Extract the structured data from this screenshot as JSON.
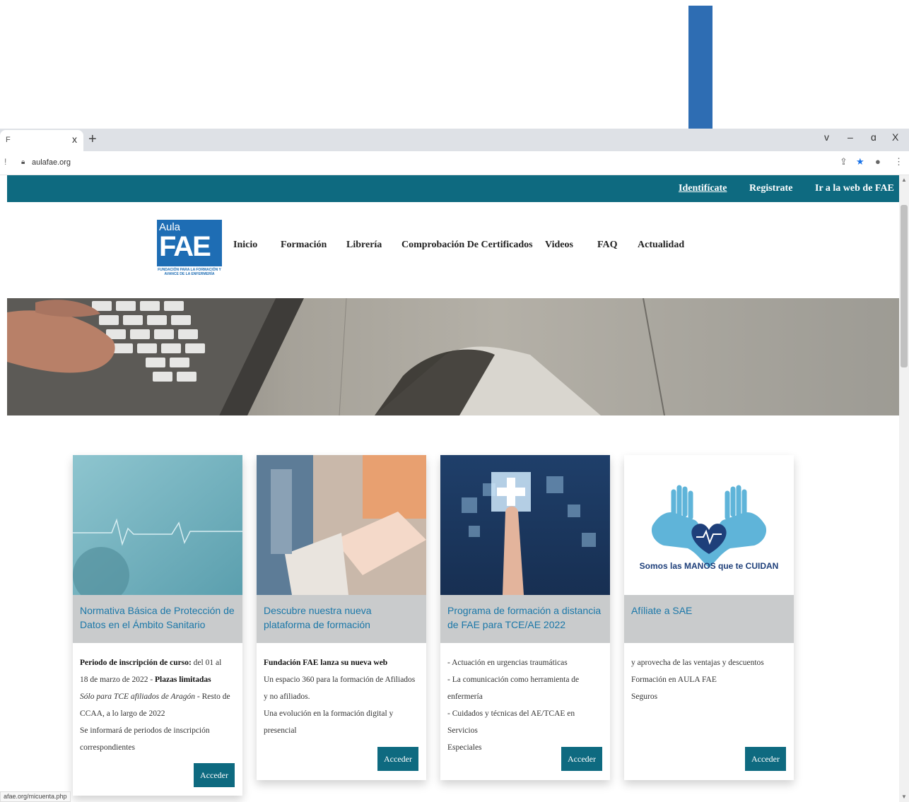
{
  "browser": {
    "tab_title": "F",
    "tab_close": "x",
    "new_tab": "+",
    "url": "aulafae.org",
    "window_controls": [
      "v",
      "–",
      "ɑ",
      "X"
    ],
    "status_url": "afae.org/micuenta.php"
  },
  "topbar": {
    "identify": "Identifícate",
    "register": "Registrate",
    "fae_web": "Ir a la web de FAE"
  },
  "logo": {
    "aula": "Aula",
    "fae": "FAE",
    "sub": "FUNDACIÓN PARA LA FORMACIÓN Y AVANCE DE LA ENFERMERÍA"
  },
  "nav": [
    "Inicio",
    "Formación",
    "Librería",
    "Comprobación De Certificados",
    "Videos",
    "FAQ",
    "Actualidad"
  ],
  "cards": [
    {
      "title": "Normativa Básica de Protección de Datos en el Ámbito Sanitario",
      "lines": [
        {
          "bold": "Periodo de inscripción de curso:",
          "text": " del 01 al"
        },
        {
          "text": "18 de marzo de 2022 - ",
          "bold": "Plazas limitadas"
        },
        {
          "italic": "Sólo para TCE afiliados de Aragón",
          "text": " - Resto de"
        },
        {
          "text": "CCAA, a lo largo de 2022"
        },
        {
          "text": "Se informará de periodos de inscripción"
        },
        {
          "text": "correspondientes"
        }
      ],
      "button": "Acceder"
    },
    {
      "title": "Descubre nuestra nueva plataforma de formación",
      "lines": [
        {
          "bold": "Fundación FAE lanza su nueva web"
        },
        {
          "text": "Un espacio 360 para la formación de Afiliados"
        },
        {
          "text": "y no afiliados."
        },
        {
          "text": "Una evolución en la formación digital y"
        },
        {
          "text": "presencial"
        }
      ],
      "button": "Acceder"
    },
    {
      "title": "Programa de formación a distancia de FAE para TCE/AE 2022",
      "lines": [
        {
          "text": "- Actuación en urgencias traumáticas"
        },
        {
          "text": "- La comunicación como herramienta de"
        },
        {
          "text": "enfermería"
        },
        {
          "text": "- Cuidados y técnicas del AE/TCAE en Servicios"
        },
        {
          "text": "Especiales"
        }
      ],
      "button": "Acceder"
    },
    {
      "title": "Afíliate a SAE",
      "image_caption": "Somos las MANOS que te CUIDAN",
      "lines": [
        {
          "text": "y aprovecha de las ventajas y descuentos"
        },
        {
          "text": "Formación en AULA FAE"
        },
        {
          "text": "Seguros"
        }
      ],
      "button": "Acceder"
    }
  ],
  "colors": {
    "brand_teal": "#0e6a80",
    "card_title_blue": "#1a77a8",
    "annotation_arrow": "#2e6db3"
  },
  "icons": [
    "arrow-down-annotation-icon",
    "lock-icon",
    "share-icon",
    "star-icon",
    "profile-icon",
    "kebab-menu-icon"
  ]
}
